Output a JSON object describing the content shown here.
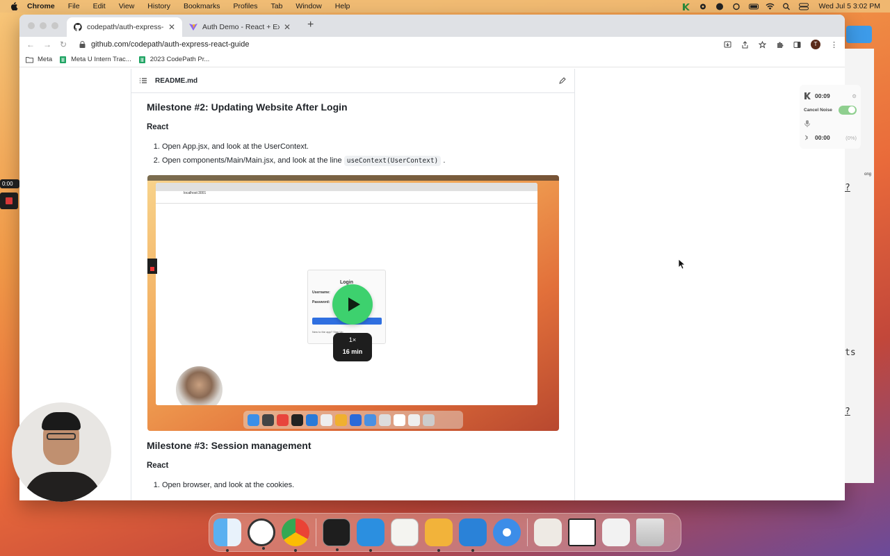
{
  "menubar": {
    "app": "Chrome",
    "items": [
      "File",
      "Edit",
      "View",
      "History",
      "Bookmarks",
      "Profiles",
      "Tab",
      "Window",
      "Help"
    ],
    "clock": "Wed Jul 5  3:02 PM"
  },
  "browser": {
    "tabs": [
      {
        "title": "codepath/auth-express-react-",
        "icon": "github-icon"
      },
      {
        "title": "Auth Demo - React + Express",
        "icon": "vite-icon"
      }
    ],
    "url": "github.com/codepath/auth-express-react-guide",
    "profile_initial": "T",
    "bookmarks": [
      {
        "label": "Meta",
        "icon": "folder-icon"
      },
      {
        "label": "Meta U Intern Trac...",
        "icon": "sheets-icon"
      },
      {
        "label": "2023 CodePath Pr...",
        "icon": "sheets-icon"
      }
    ]
  },
  "readme": {
    "filename": "README.md",
    "milestone2": {
      "title": "Milestone #2: Updating Website After Login",
      "subtitle": "React",
      "step1": "Open App.jsx, and look at the UserContext.",
      "step2_text": "Open components/Main/Main.jsx, and look at the line",
      "step2_code": "useContext(UserContext)",
      "step2_end": "."
    },
    "video": {
      "speed": "1×",
      "duration": "16 min",
      "inner_url": "localhost:3001",
      "inner_title": "Login",
      "inner_username": "Username:",
      "inner_password": "Password:",
      "inner_new": "New to the app? Sign Up"
    },
    "milestone3": {
      "title": "Milestone #3: Session management",
      "subtitle": "React",
      "step1": "Open browser, and look at the cookies."
    }
  },
  "recorder": {
    "time": "0:00"
  },
  "loom": {
    "elapsed": "00:09",
    "cancel_noise_label": "Cancel Noise",
    "audio_time": "00:00",
    "audio_pct": "(0%)"
  },
  "side": {
    "q1": "?",
    "ts": "ts",
    "q2": "?",
    "ong": "ong"
  }
}
